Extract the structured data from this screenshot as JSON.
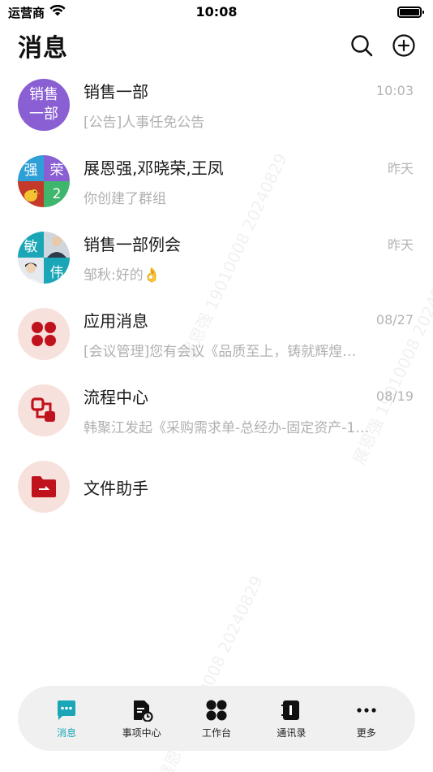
{
  "status_bar": {
    "carrier": "运营商",
    "time": "10:08"
  },
  "header": {
    "title": "消息"
  },
  "conversations": [
    {
      "name": "销售一部",
      "time": "10:03",
      "preview": "[公告]人事任免公告",
      "avatar_lines": [
        "销售",
        "一部"
      ],
      "avatar_color": "#8a5fd3"
    },
    {
      "name": "展恩强,邓晓荣,王凤",
      "time": "昨天",
      "preview": "你创建了群组",
      "avatar_cells": [
        "强",
        "荣",
        "",
        "2"
      ]
    },
    {
      "name": "销售一部例会",
      "time": "昨天",
      "preview": "邹秋:好的",
      "preview_emoji": "👌",
      "avatar_cells": [
        "敏",
        "",
        "",
        "伟"
      ]
    },
    {
      "name": "应用消息",
      "time": "08/27",
      "preview": "[会议管理]您有会议《品质至上，铸就辉煌…",
      "icon": "apps-dots-icon"
    },
    {
      "name": "流程中心",
      "time": "08/19",
      "preview": "韩聚江发起《采购需求单-总经办-固定资产-1…",
      "icon": "workflow-icon"
    },
    {
      "name": "文件助手",
      "icon": "folder-icon"
    }
  ],
  "tabbar": {
    "items": [
      {
        "label": "消息",
        "icon": "chat-bubble-icon",
        "active": true
      },
      {
        "label": "事项中心",
        "icon": "task-doc-icon"
      },
      {
        "label": "工作台",
        "icon": "grid-dots-icon"
      },
      {
        "label": "通讯录",
        "icon": "contacts-book-icon"
      },
      {
        "label": "更多",
        "icon": "more-dots-icon"
      }
    ]
  },
  "colors": {
    "accent": "#1aa6b7",
    "app_icon_red": "#c0121c",
    "app_icon_bg": "#f7e1dc"
  }
}
